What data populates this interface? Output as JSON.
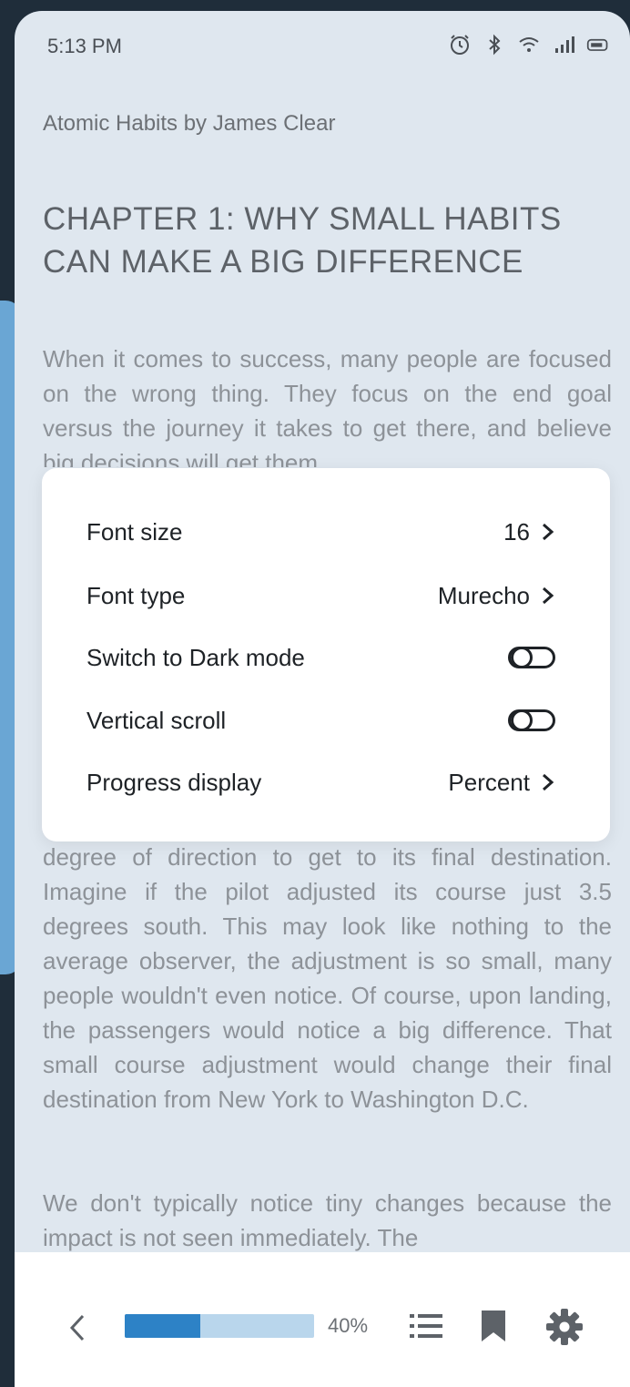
{
  "status_bar": {
    "time": "5:13 PM",
    "icons": [
      "alarm-icon",
      "bluetooth-icon",
      "wifi-icon",
      "signal-icon",
      "battery-icon"
    ]
  },
  "reader": {
    "book_title": "Atomic Habits by James Clear",
    "chapter_title": "CHAPTER 1: WHY SMALL HABITS CAN MAKE A BIG DIFFERENCE",
    "paragraphs": [
      "When it comes to success, many people are focused on the wrong thing. They focus on the end goal versus the journey it takes to get there, and believe big decisions will get them",
      "degree of direction to get to its final destination. Imagine if the pilot adjusted its course just 3.5 degrees south. This may look like nothing to the average observer, the adjustment is so small, many people wouldn't even notice. Of course, upon landing, the passengers would notice a big difference. That small course adjustment would change their final destination from New York to Washington D.C.",
      "We don't typically notice tiny changes because the impact is not seen immediately. The"
    ]
  },
  "settings": {
    "font_size": {
      "label": "Font size",
      "value": "16"
    },
    "font_type": {
      "label": "Font type",
      "value": "Murecho"
    },
    "dark_mode": {
      "label": "Switch to Dark mode",
      "enabled": false
    },
    "vertical_scroll": {
      "label": "Vertical scroll",
      "enabled": false
    },
    "progress_display": {
      "label": "Progress display",
      "value": "Percent"
    }
  },
  "bottom_bar": {
    "progress_percent": 40,
    "progress_text": "40%",
    "icons": [
      "back-icon",
      "table-of-contents-icon",
      "bookmark-icon",
      "gear-icon"
    ]
  },
  "colors": {
    "accent": "#2d82c6",
    "progress_track": "#b9d6ec",
    "page_background": "#dfe7ef"
  }
}
